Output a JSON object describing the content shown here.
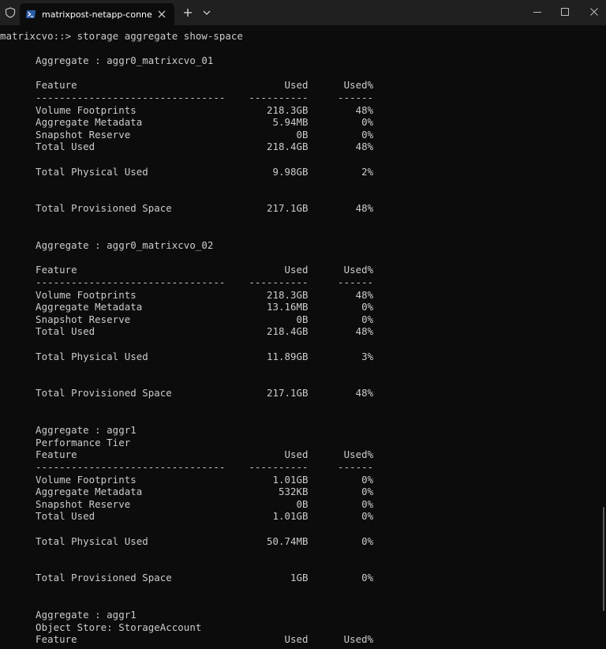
{
  "window": {
    "tab_title": "matrixpost-netapp-connector",
    "tab_close_label": "✕",
    "new_tab_label": "+",
    "dropdown_label": "⌄",
    "minimize_label": "—",
    "maximize_label": "☐",
    "close_label": "✕"
  },
  "icons": {
    "shield": "shield-icon",
    "powershell": "powershell-icon",
    "colors": {
      "titlebar": "#202020",
      "terminal_bg": "#0c0c0c",
      "text": "#cccccc",
      "ps_icon": "#2b5ea8"
    }
  },
  "terminal": {
    "lines": [
      "matrixcvo::> storage aggregate show-space",
      "",
      "      Aggregate : aggr0_matrixcvo_01",
      "",
      "      Feature                                   Used      Used%",
      "      --------------------------------    ----------     ------",
      "      Volume Footprints                      218.3GB        48%",
      "      Aggregate Metadata                      5.94MB         0%",
      "      Snapshot Reserve                            0B         0%",
      "      Total Used                             218.4GB        48%",
      "",
      "      Total Physical Used                     9.98GB         2%",
      "",
      "",
      "      Total Provisioned Space                217.1GB        48%",
      "",
      "",
      "      Aggregate : aggr0_matrixcvo_02",
      "",
      "      Feature                                   Used      Used%",
      "      --------------------------------    ----------     ------",
      "      Volume Footprints                      218.3GB        48%",
      "      Aggregate Metadata                     13.16MB         0%",
      "      Snapshot Reserve                            0B         0%",
      "      Total Used                             218.4GB        48%",
      "",
      "      Total Physical Used                    11.89GB         3%",
      "",
      "",
      "      Total Provisioned Space                217.1GB        48%",
      "",
      "",
      "      Aggregate : aggr1",
      "      Performance Tier",
      "      Feature                                   Used      Used%",
      "      --------------------------------    ----------     ------",
      "      Volume Footprints                       1.01GB         0%",
      "      Aggregate Metadata                       532KB         0%",
      "      Snapshot Reserve                            0B         0%",
      "      Total Used                              1.01GB         0%",
      "",
      "      Total Physical Used                    50.74MB         0%",
      "",
      "",
      "      Total Provisioned Space                    1GB         0%",
      "",
      "",
      "      Aggregate : aggr1",
      "      Object Store: StorageAccount",
      "      Feature                                   Used      Used%"
    ]
  }
}
